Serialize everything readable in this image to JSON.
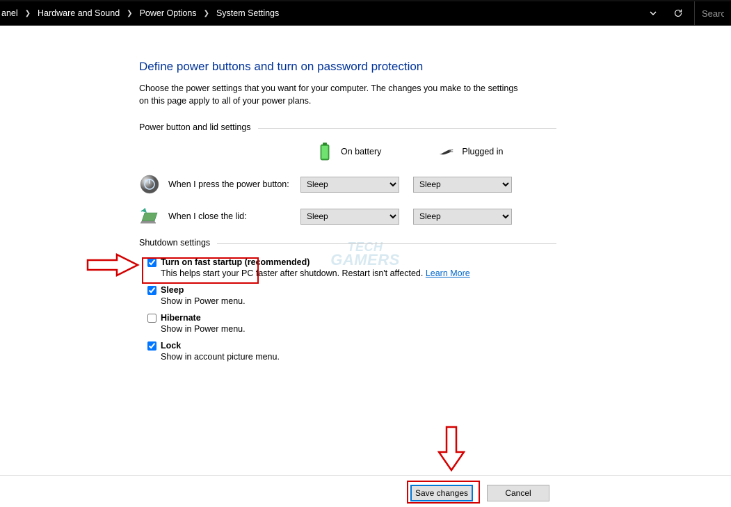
{
  "breadcrumb": {
    "items": [
      "anel",
      "Hardware and Sound",
      "Power Options",
      "System Settings"
    ]
  },
  "search": {
    "placeholder": "Search"
  },
  "page": {
    "title": "Define power buttons and turn on password protection",
    "description": "Choose the power settings that you want for your computer. The changes you make to the settings on this page apply to all of your power plans."
  },
  "groups": {
    "power_button": "Power button and lid settings",
    "shutdown": "Shutdown settings"
  },
  "mode": {
    "battery": "On battery",
    "plugged": "Plugged in"
  },
  "settings": {
    "power_button": {
      "label": "When I press the power button:",
      "battery_value": "Sleep",
      "plugged_value": "Sleep"
    },
    "close_lid": {
      "label": "When I close the lid:",
      "battery_value": "Sleep",
      "plugged_value": "Sleep"
    }
  },
  "shutdown": {
    "fast_startup": {
      "label": "Turn on fast startup (recommended)",
      "desc": "This helps start your PC faster after shutdown. Restart isn't affected. ",
      "link": "Learn More",
      "checked": true
    },
    "sleep": {
      "label": "Sleep",
      "desc": "Show in Power menu.",
      "checked": true
    },
    "hibernate": {
      "label": "Hibernate",
      "desc": "Show in Power menu.",
      "checked": false
    },
    "lock": {
      "label": "Lock",
      "desc": "Show in account picture menu.",
      "checked": true
    }
  },
  "buttons": {
    "save": "Save changes",
    "cancel": "Cancel"
  },
  "watermark": {
    "line1": "TECH",
    "line2": "GAMERS"
  }
}
